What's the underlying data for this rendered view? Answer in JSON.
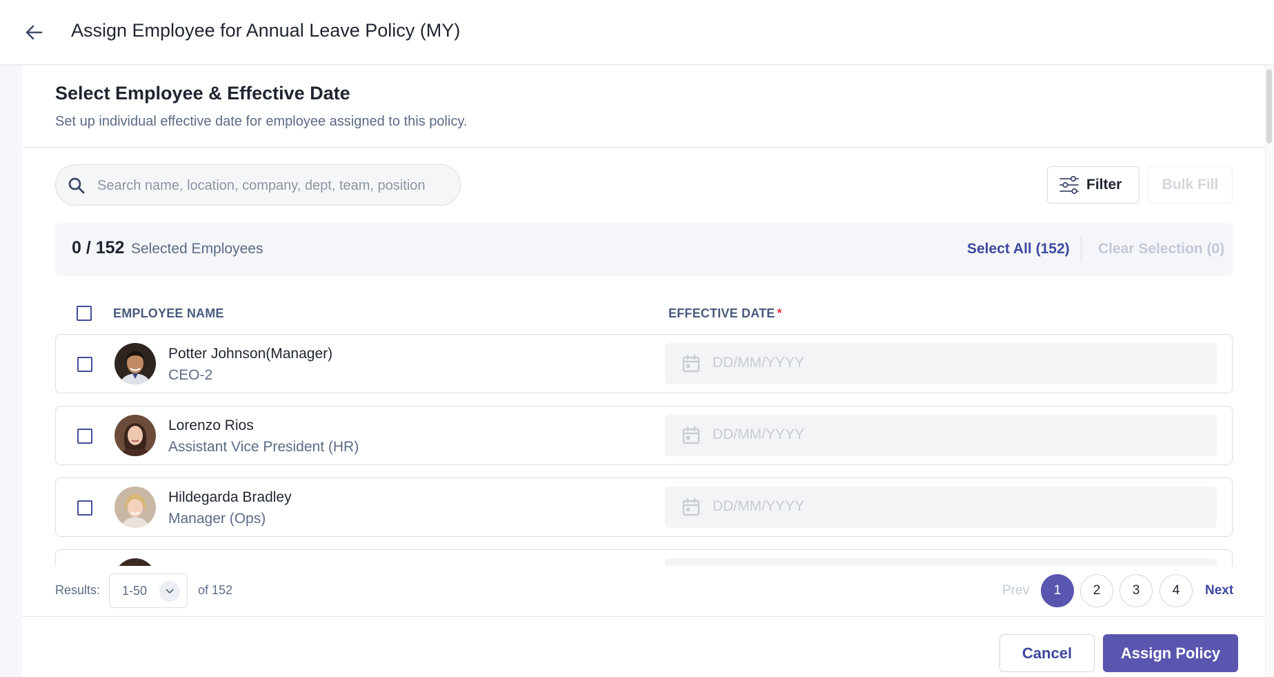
{
  "header": {
    "title": "Assign Employee for Annual Leave Policy (MY)"
  },
  "section": {
    "title": "Select Employee & Effective Date",
    "subtitle": "Set up individual effective date for employee assigned to this policy."
  },
  "toolbar": {
    "search_placeholder": "Search name, location, company, dept, team, position",
    "filter_label": "Filter",
    "bulk_fill_label": "Bulk Fill"
  },
  "selection": {
    "count": "0 / 152",
    "label": "Selected Employees",
    "select_all": "Select All (152)",
    "clear": "Clear Selection (0)"
  },
  "table": {
    "col_name": "EMPLOYEE NAME",
    "col_date": "EFFECTIVE DATE",
    "required_mark": "*",
    "date_placeholder": "DD/MM/YYYY",
    "rows": [
      {
        "name": "Potter Johnson(Manager)",
        "position": "CEO-2"
      },
      {
        "name": "Lorenzo Rios",
        "position": "Assistant Vice President (HR)"
      },
      {
        "name": "Hildegarda Bradley",
        "position": "Manager (Ops)"
      }
    ]
  },
  "pagination": {
    "results_label": "Results:",
    "range": "1-50",
    "of_total": "of 152",
    "prev": "Prev",
    "pages": [
      "1",
      "2",
      "3",
      "4"
    ],
    "current_page": "1",
    "next": "Next"
  },
  "footer": {
    "cancel": "Cancel",
    "assign": "Assign Policy"
  },
  "colors": {
    "primary": "#5a56b0",
    "link": "#3e47a0",
    "required": "#e0383e"
  }
}
